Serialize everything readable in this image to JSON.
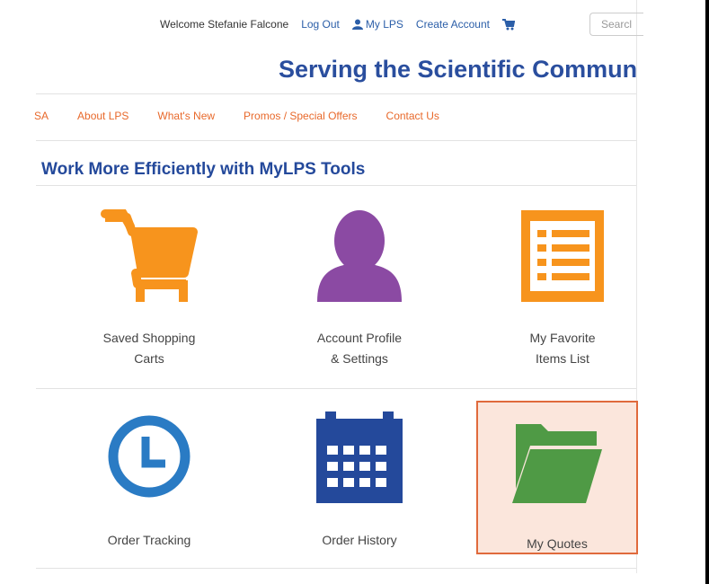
{
  "header": {
    "welcome": "Welcome Stefanie Falcone",
    "logout": "Log Out",
    "mylps": "My LPS",
    "create_account": "Create Account",
    "search_placeholder": "Searcl",
    "tagline": "Serving the Scientific Commun"
  },
  "nav": {
    "items": [
      "SA",
      "About LPS",
      "What's New",
      "Promos / Special Offers",
      "Contact Us"
    ]
  },
  "section_title": "Work More Efficiently with MyLPS Tools",
  "tiles": {
    "saved_carts": {
      "line1": "Saved Shopping",
      "line2": "Carts",
      "icon": "shopping-cart-icon"
    },
    "account_profile": {
      "line1": "Account Profile",
      "line2": "& Settings",
      "icon": "user-icon"
    },
    "favorites": {
      "line1": "My Favorite",
      "line2": "Items List",
      "icon": "list-icon"
    },
    "order_tracking": {
      "line1": "Order Tracking",
      "icon": "clock-icon"
    },
    "order_history": {
      "line1": "Order History",
      "icon": "calendar-icon"
    },
    "my_quotes": {
      "line1": "My Quotes",
      "icon": "folder-open-icon"
    }
  },
  "colors": {
    "orange": "#f7941d",
    "purple": "#8b4aa3",
    "blue": "#2a7bc4",
    "navy": "#24499b",
    "green": "#4f9a45",
    "highlight_bg": "#fbe6dc",
    "highlight_border": "#e06a3c"
  }
}
